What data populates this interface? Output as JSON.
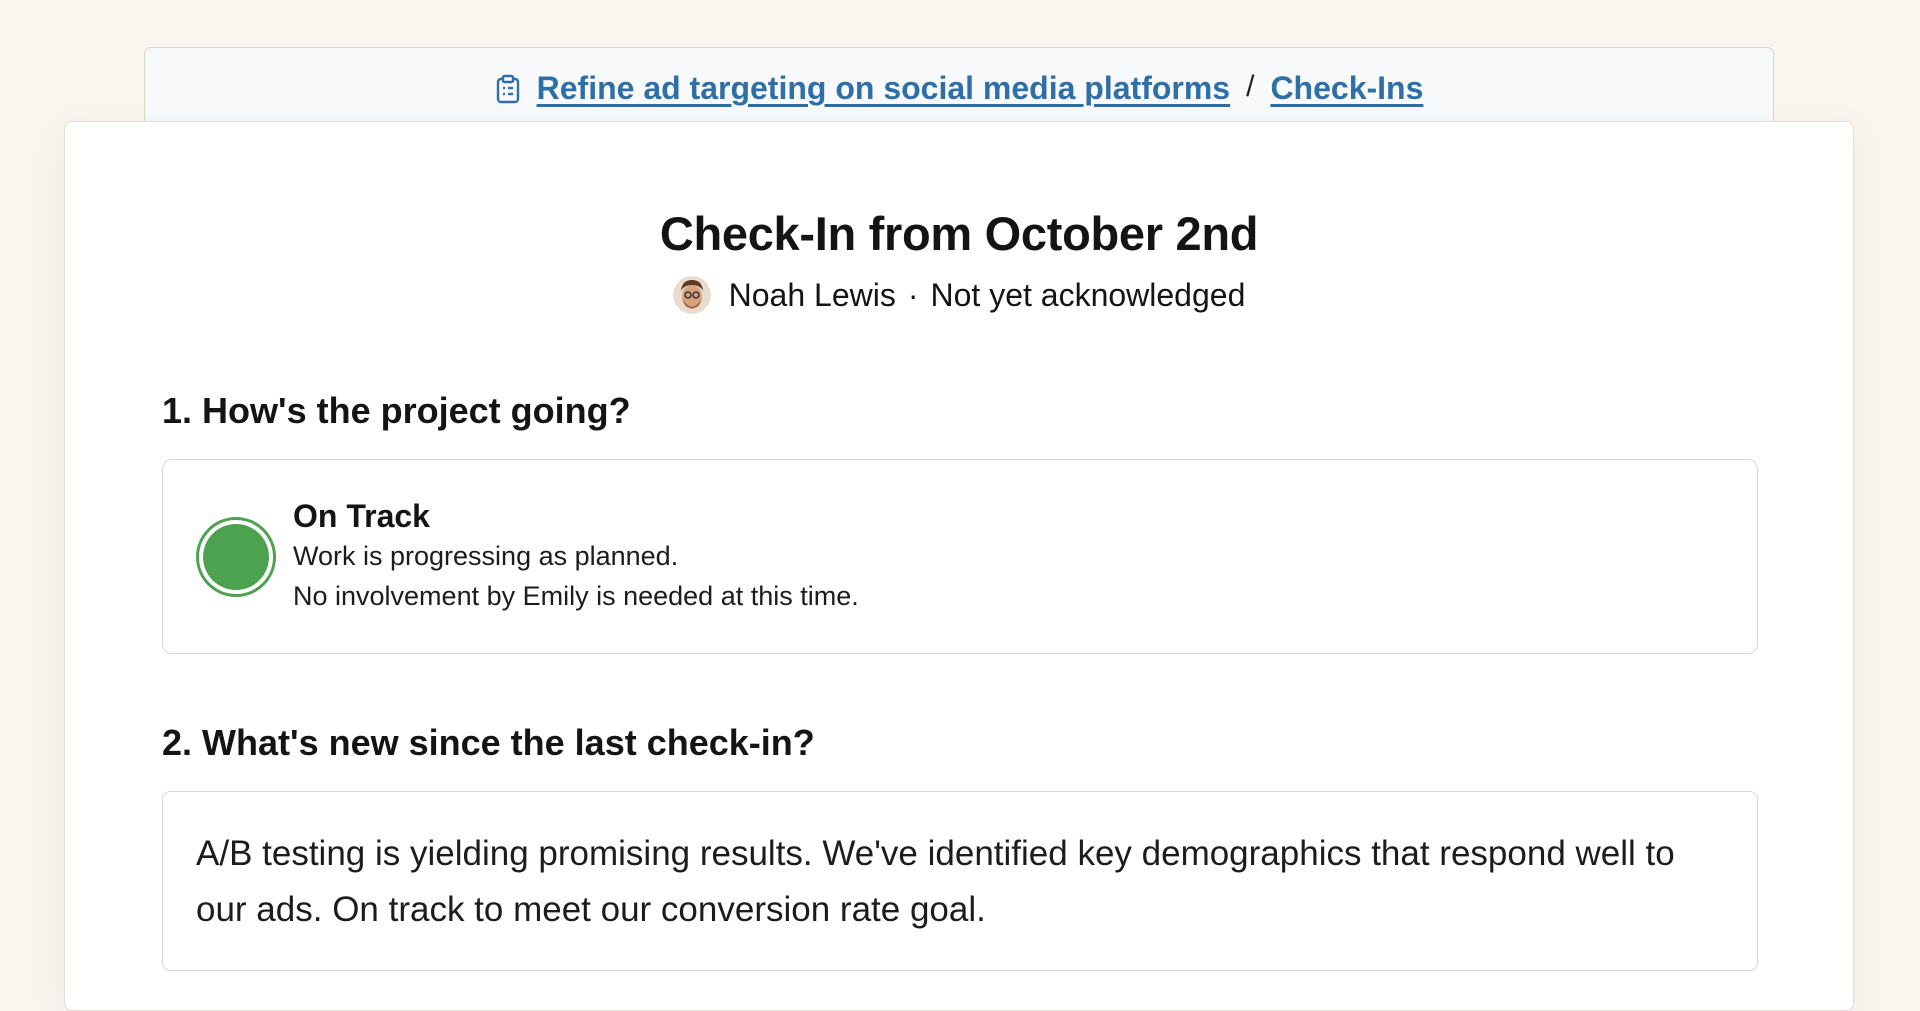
{
  "breadcrumb": {
    "project_label": "Refine ad targeting on social media platforms",
    "separator": "/",
    "checkins_label": "Check-Ins"
  },
  "checkin": {
    "title": "Check-In from October 2nd",
    "author": "Noah Lewis",
    "meta_separator": "·",
    "acknowledgement_status": "Not yet acknowledged"
  },
  "questions": [
    {
      "heading": "1. How's the project going?",
      "status": {
        "label": "On Track",
        "color": "#4da24f",
        "description_line1": "Work is progressing as planned.",
        "description_line2": "No involvement by Emily is needed at this time."
      }
    },
    {
      "heading": "2. What's new since the last check-in?",
      "answer": "A/B testing is yielding promising results. We've identified key demographics that respond well to our ads. On track to meet our conversion rate goal."
    }
  ],
  "icons": {
    "breadcrumb": "clipboard-icon",
    "author": "avatar"
  },
  "colors": {
    "link": "#2f6fa7",
    "background": "#fbf5ef",
    "on_track": "#4da24f"
  }
}
